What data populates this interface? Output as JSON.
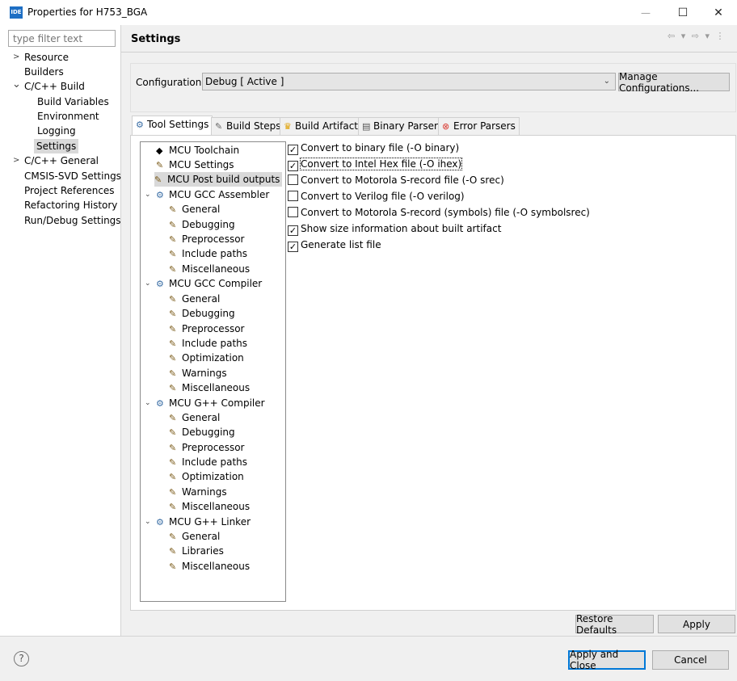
{
  "window": {
    "title": "Properties for H753_BGA",
    "app_icon": "IDE",
    "minimize_glyph": "—",
    "maximize_glyph": "☐",
    "close_glyph": "✕"
  },
  "filter": {
    "placeholder": "type filter text"
  },
  "nav": {
    "items": [
      {
        "label": "Resource",
        "twisty": ">"
      },
      {
        "label": "Builders"
      },
      {
        "label": "C/C++ Build",
        "twisty": "⌄"
      },
      {
        "label": "Build Variables"
      },
      {
        "label": "Environment"
      },
      {
        "label": "Logging"
      },
      {
        "label": "Settings",
        "selected": true
      },
      {
        "label": "C/C++ General",
        "twisty": ">"
      },
      {
        "label": "CMSIS-SVD Settings"
      },
      {
        "label": "Project References"
      },
      {
        "label": "Refactoring History"
      },
      {
        "label": "Run/Debug Settings"
      }
    ]
  },
  "page": {
    "title": "Settings",
    "nav_arrows": "⇦ ▾ ⇨ ▾ ⋮"
  },
  "configuration": {
    "label": "Configuration:",
    "value": "Debug  [ Active ]",
    "manage_button": "Manage Configurations..."
  },
  "tabs": [
    {
      "label": "Tool Settings",
      "icon": "tool-settings-icon",
      "active": true
    },
    {
      "label": "Build Steps",
      "icon": "build-steps-icon"
    },
    {
      "label": "Build Artifact",
      "icon": "build-artifact-icon"
    },
    {
      "label": "Binary Parsers",
      "icon": "binary-parsers-icon"
    },
    {
      "label": "Error Parsers",
      "icon": "error-parsers-icon"
    }
  ],
  "tree": {
    "toolchain": "MCU Toolchain",
    "mcu_settings": "MCU Settings",
    "post_build": "MCU Post build outputs",
    "assembler": {
      "label": "MCU GCC Assembler",
      "children": [
        "General",
        "Debugging",
        "Preprocessor",
        "Include paths",
        "Miscellaneous"
      ]
    },
    "compiler": {
      "label": "MCU GCC Compiler",
      "children": [
        "General",
        "Debugging",
        "Preprocessor",
        "Include paths",
        "Optimization",
        "Warnings",
        "Miscellaneous"
      ]
    },
    "gpp_compiler": {
      "label": "MCU G++ Compiler",
      "children": [
        "General",
        "Debugging",
        "Preprocessor",
        "Include paths",
        "Optimization",
        "Warnings",
        "Miscellaneous"
      ]
    },
    "linker": {
      "label": "MCU G++ Linker",
      "children": [
        "General",
        "Libraries",
        "Miscellaneous"
      ]
    }
  },
  "options": [
    {
      "label": "Convert to binary file (-O binary)",
      "checked": true
    },
    {
      "label": "Convert to Intel Hex file (-O ihex)",
      "checked": true,
      "focused": true
    },
    {
      "label": "Convert to Motorola S-record file (-O srec)",
      "checked": false
    },
    {
      "label": "Convert to Verilog file (-O verilog)",
      "checked": false
    },
    {
      "label": "Convert to Motorola S-record (symbols) file (-O symbolsrec)",
      "checked": false
    },
    {
      "label": "Show size information about built artifact",
      "checked": true
    },
    {
      "label": "Generate list file",
      "checked": true
    }
  ],
  "buttons": {
    "restore_defaults": "Restore Defaults",
    "apply": "Apply",
    "apply_and_close": "Apply and Close",
    "cancel": "Cancel",
    "help": "?"
  },
  "colors": {
    "selection_gray": "#d9d9d9",
    "default_button_border": "#0078d7",
    "app_icon_blue": "#1e6fc4"
  }
}
